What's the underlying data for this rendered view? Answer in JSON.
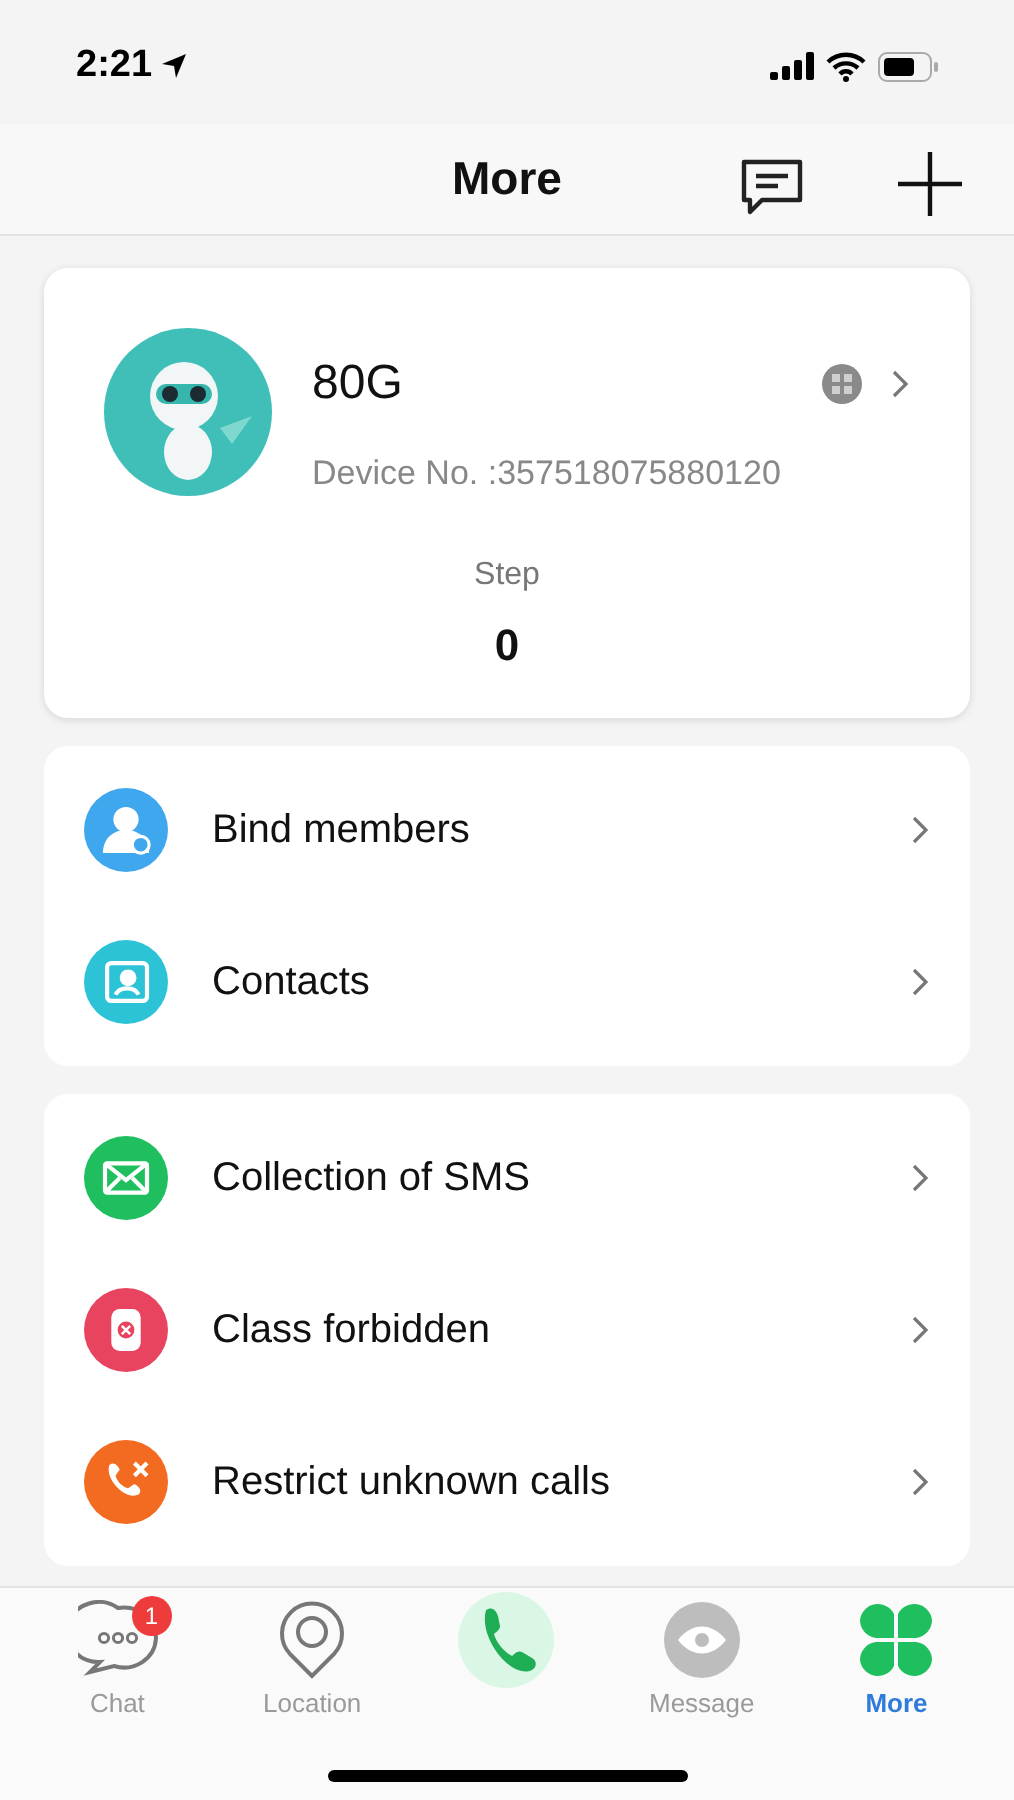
{
  "status_bar": {
    "time": "2:21"
  },
  "header": {
    "title": "More"
  },
  "device": {
    "name": "80G",
    "number": "Device No. :357518075880120",
    "step_label": "Step",
    "step_value": "0"
  },
  "groups": [
    {
      "items": [
        {
          "label": "Bind members",
          "kind": "members",
          "color": "#3fa7ee"
        },
        {
          "label": "Contacts",
          "kind": "contacts",
          "color": "#2cc3d6"
        }
      ]
    },
    {
      "items": [
        {
          "label": "Collection of SMS",
          "kind": "sms",
          "color": "#1fbf5f"
        },
        {
          "label": "Class forbidden",
          "kind": "forbidden",
          "color": "#e8435f"
        },
        {
          "label": "Restrict unknown calls",
          "kind": "restrict",
          "color": "#f26b21"
        }
      ]
    }
  ],
  "tabs": [
    {
      "label": "Chat",
      "kind": "chat",
      "badge": "1",
      "selected": false
    },
    {
      "label": "Location",
      "kind": "location",
      "selected": false
    },
    {
      "kind": "call",
      "selected": false
    },
    {
      "label": "Message",
      "kind": "message",
      "selected": false
    },
    {
      "label": "More",
      "kind": "more",
      "selected": true
    }
  ]
}
